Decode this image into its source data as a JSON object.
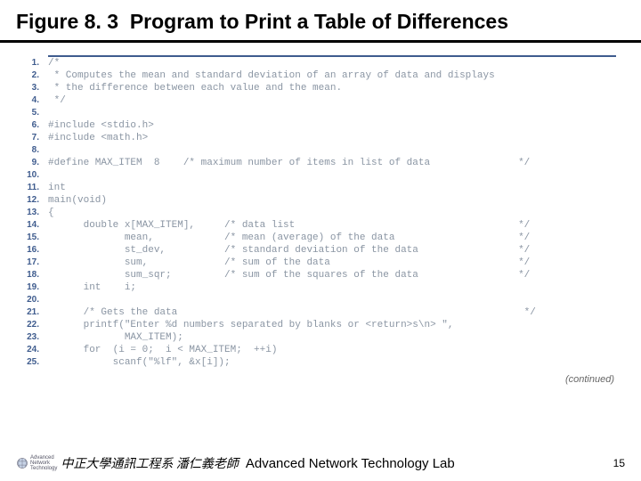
{
  "title": {
    "fig": "Figure 8. 3",
    "text": "Program to Print a Table of Differences"
  },
  "code": {
    "lines": [
      "/*",
      " * Computes the mean and standard deviation of an array of data and displays",
      " * the difference between each value and the mean.",
      " */",
      "",
      "#include <stdio.h>",
      "#include <math.h>",
      "",
      "#define MAX_ITEM  8    /* maximum number of items in list of data               */",
      "",
      "int",
      "main(void)",
      "{",
      "      double x[MAX_ITEM],     /* data list                                      */",
      "             mean,            /* mean (average) of the data                     */",
      "             st_dev,          /* standard deviation of the data                 */",
      "             sum,             /* sum of the data                                */",
      "             sum_sqr;         /* sum of the squares of the data                 */",
      "      int    i;",
      "",
      "      /* Gets the data                                                           */",
      "      printf(\"Enter %d numbers separated by blanks or <return>s\\n> \",",
      "             MAX_ITEM);",
      "      for  (i = 0;  i < MAX_ITEM;  ++i)",
      "           scanf(\"%lf\", &x[i]);"
    ]
  },
  "continued": "(continued)",
  "footer": {
    "logo_lines": [
      "Advanced",
      "Network",
      "Technology"
    ],
    "chinese": "中正大學通訊工程系 潘仁義老師",
    "english": "Advanced Network Technology Lab",
    "page": "15"
  }
}
